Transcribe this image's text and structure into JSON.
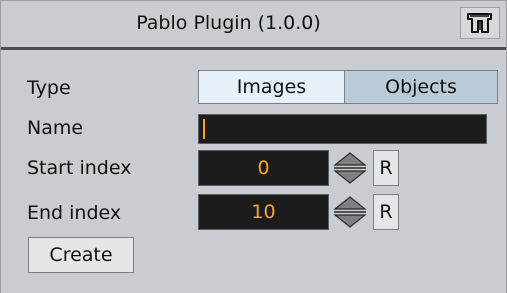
{
  "window": {
    "title": "Pablo Plugin (1.0.0)",
    "logo_icon": "viz-logo-icon"
  },
  "form": {
    "type": {
      "label": "Type",
      "options": [
        "Images",
        "Objects"
      ],
      "selected": "Images"
    },
    "name": {
      "label": "Name",
      "value": ""
    },
    "start_index": {
      "label": "Start index",
      "value": "0",
      "reset_label": "R"
    },
    "end_index": {
      "label": "End index",
      "value": "10",
      "reset_label": "R"
    },
    "create_label": "Create"
  },
  "colors": {
    "panel_bg": "#c9cdd1",
    "field_bg": "#1c1c1c",
    "value_text": "#f5a623",
    "segment_active": "#e6f0f8",
    "segment_inactive": "#b9cbd8",
    "divider": "#4a4e53"
  }
}
